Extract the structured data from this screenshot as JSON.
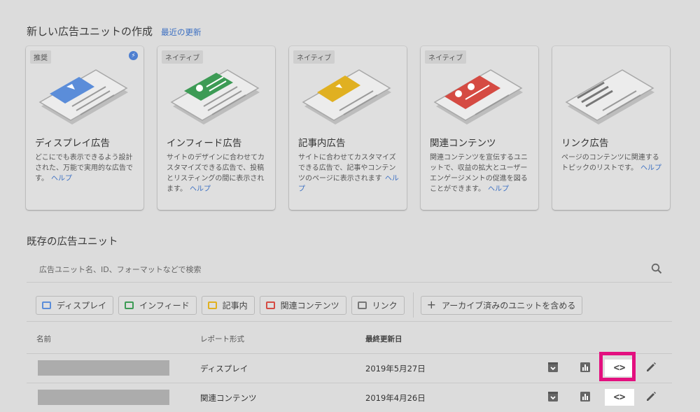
{
  "header": {
    "title": "新しい広告ユニットの作成",
    "recent_link": "最近の更新"
  },
  "cards": [
    {
      "badge": "推奨",
      "title": "ディスプレイ広告",
      "desc": "どこにでも表示できるよう設計された、万能で実用的な広告です。",
      "help": "ヘルプ",
      "accent": "#5b8dd9",
      "illus": "display"
    },
    {
      "badge": "ネイティブ",
      "title": "インフィード広告",
      "desc": "サイトのデザインに合わせてカスタマイズできる広告で、投稿とリスティングの間に表示されます。",
      "help": "ヘルプ",
      "accent": "#3d9b55",
      "illus": "infeed"
    },
    {
      "badge": "ネイティブ",
      "title": "記事内広告",
      "desc": "サイトに合わせてカスタマイズできる広告で、記事やコンテンツのページに表示されます",
      "help": "ヘルプ",
      "accent": "#e0b021",
      "illus": "inarticle"
    },
    {
      "badge": "ネイティブ",
      "title": "関連コンテンツ",
      "desc": "関連コンテンツを宣伝するユニットで、収益の拡大とユーザー エンゲージメントの促進を図ることができます。",
      "help": "ヘルプ",
      "accent": "#d54b43",
      "illus": "related"
    },
    {
      "badge": "",
      "title": "リンク広告",
      "desc": "ページのコンテンツに関連するトピックのリストです。",
      "help": "ヘルプ",
      "accent": "#777777",
      "illus": "link"
    }
  ],
  "existing": {
    "title": "既存の広告ユニット",
    "search_placeholder": "広告ユニット名、ID、フォーマットなどで検索"
  },
  "filters": [
    {
      "label": "ディスプレイ",
      "color": "#5b8dd9"
    },
    {
      "label": "インフィード",
      "color": "#3d9b55"
    },
    {
      "label": "記事内",
      "color": "#e0b021"
    },
    {
      "label": "関連コンテンツ",
      "color": "#d54b43"
    },
    {
      "label": "リンク",
      "color": "#777777"
    }
  ],
  "archive_chip": "アーカイブ済みのユニットを含める",
  "table": {
    "headers": {
      "name": "名前",
      "format": "レポート形式",
      "updated": "最終更新日"
    },
    "rows": [
      {
        "format": "ディスプレイ",
        "updated": "2019年5月27日"
      },
      {
        "format": "関連コンテンツ",
        "updated": "2019年4月26日"
      }
    ],
    "code_symbol": "<>"
  },
  "colors": {
    "highlight": "#e3107f",
    "link": "#3b6fc2"
  }
}
